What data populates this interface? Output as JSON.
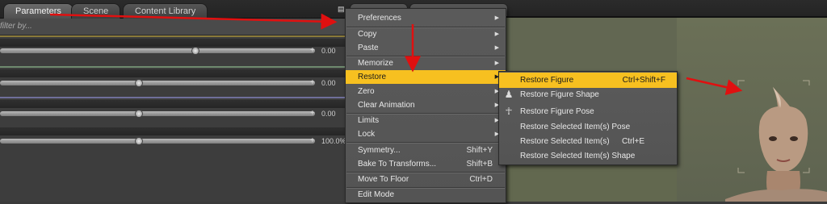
{
  "tabs": [
    {
      "label": "Parameters",
      "active": true
    },
    {
      "label": "Scene",
      "active": false
    },
    {
      "label": "Content Library",
      "active": false
    }
  ],
  "filter": {
    "placeholder": "filter by..."
  },
  "params": [
    {
      "value": "0.00"
    },
    {
      "value": "0.00"
    },
    {
      "value": "0.00"
    },
    {
      "value": "100.0%"
    }
  ],
  "menu": {
    "items": [
      {
        "label": "Preferences",
        "submenu": true
      },
      {
        "label": "Copy",
        "submenu": true
      },
      {
        "label": "Paste",
        "submenu": true
      },
      {
        "label": "Memorize",
        "submenu": true
      },
      {
        "label": "Restore",
        "submenu": true,
        "highlighted": true
      },
      {
        "label": "Zero",
        "submenu": true
      },
      {
        "label": "Clear Animation",
        "submenu": true
      },
      {
        "label": "Limits",
        "submenu": true
      },
      {
        "label": "Lock",
        "submenu": true
      },
      {
        "label": "Symmetry...",
        "shortcut": "Shift+Y"
      },
      {
        "label": "Bake To Transforms...",
        "shortcut": "Shift+B"
      },
      {
        "label": "Move To Floor",
        "shortcut": "Ctrl+D"
      },
      {
        "label": "Edit Mode"
      }
    ]
  },
  "submenu": {
    "items": [
      {
        "label": "Restore Figure",
        "shortcut": "Ctrl+Shift+F",
        "highlighted": true,
        "icon": "figure-icon"
      },
      {
        "label": "Restore Figure Shape",
        "icon": "figure-shape-icon"
      },
      {
        "label": "Restore Figure Pose",
        "icon": "figure-pose-icon"
      },
      {
        "label": "Restore Selected Item(s) Pose"
      },
      {
        "label": "Restore Selected Item(s)",
        "shortcut": "Ctrl+E"
      },
      {
        "label": "Restore Selected Item(s) Shape"
      }
    ]
  },
  "colors": {
    "highlight": "#f7c020",
    "arrow": "#e01010",
    "menu_bg": "#565656"
  }
}
